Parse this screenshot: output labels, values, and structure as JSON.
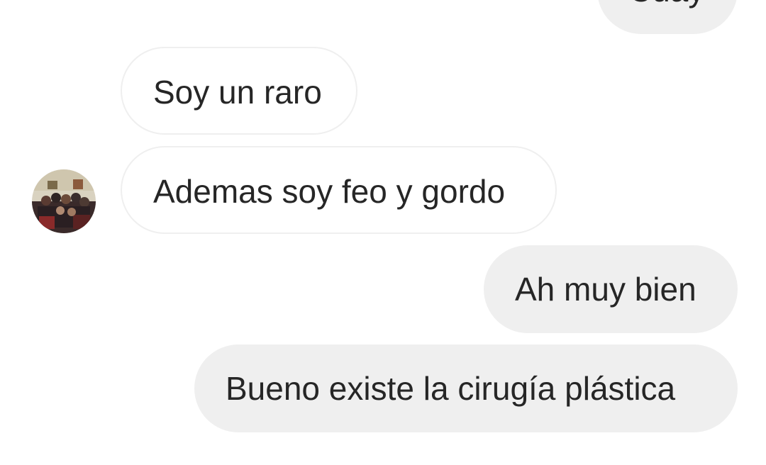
{
  "messages": [
    {
      "sender": "me",
      "text": "Cuay"
    },
    {
      "sender": "them",
      "text": "Soy un raro"
    },
    {
      "sender": "them",
      "text": "Ademas soy feo y gordo"
    },
    {
      "sender": "me",
      "text": "Ah muy bien"
    },
    {
      "sender": "me",
      "text": "Bueno existe la cirugía plástica"
    }
  ],
  "colors": {
    "outgoing_bubble": "#efefef",
    "incoming_border": "#efefef",
    "text": "#262626",
    "background": "#ffffff"
  },
  "icons": {
    "avatar": "group-photo-avatar"
  }
}
